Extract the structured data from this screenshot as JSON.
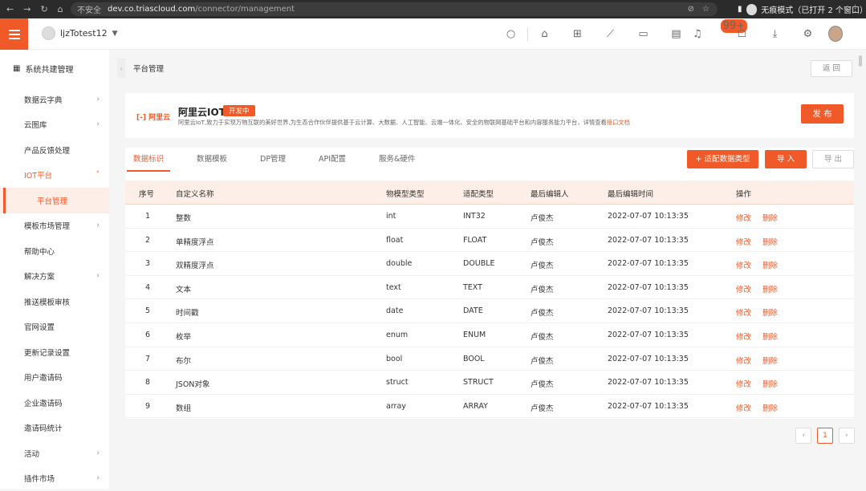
{
  "browser": {
    "security": "不安全",
    "url_host": "dev.co.triascloud.com",
    "url_path": "/connector/management",
    "incognito": "无痕模式（已打开 2 个窗口）"
  },
  "header": {
    "tenant": "ljzTotest12",
    "notification_count": "99+"
  },
  "sidebar": {
    "title": "系统共建管理",
    "items": [
      {
        "label": "数据云字典",
        "arrow": "›"
      },
      {
        "label": "云图库",
        "arrow": "›"
      },
      {
        "label": "产品反馈处理",
        "arrow": ""
      },
      {
        "label": "IOT平台",
        "arrow": "˄"
      },
      {
        "label": "平台管理",
        "arrow": ""
      },
      {
        "label": "模板市场管理",
        "arrow": "›"
      },
      {
        "label": "帮助中心",
        "arrow": ""
      },
      {
        "label": "解决方案",
        "arrow": "›"
      },
      {
        "label": "推送模板审核",
        "arrow": ""
      },
      {
        "label": "官网设置",
        "arrow": ""
      },
      {
        "label": "更新记录设置",
        "arrow": ""
      },
      {
        "label": "用户邀请码",
        "arrow": ""
      },
      {
        "label": "企业邀请码",
        "arrow": ""
      },
      {
        "label": "邀请码统计",
        "arrow": ""
      },
      {
        "label": "活动",
        "arrow": "›"
      },
      {
        "label": "插件市场",
        "arrow": "›"
      }
    ]
  },
  "breadcrumb": {
    "title": "平台管理",
    "return_label": "返 回"
  },
  "platform": {
    "logo_text": "[-] 阿里云",
    "name": "阿里云IOT",
    "status": "开发中",
    "description": "阿里云IoT,致力于实现万物互联的美好世界,为生态合作伙伴提供基于云计算、大数据、人工智能、云端一体化、安全的物联网基础平台和内容服务能力平台，详情查看",
    "doc_link": "接口文档",
    "publish_label": "发 布"
  },
  "tabs": [
    "数据标识",
    "数据模板",
    "DP管理",
    "API配置",
    "服务&硬件"
  ],
  "actions": {
    "adapt": "+ 适配数据类型",
    "import": "导 入",
    "export": "导 出"
  },
  "table": {
    "headers": [
      "序号",
      "自定义名称",
      "物模型类型",
      "适配类型",
      "最后编辑人",
      "最后编辑时间",
      "操作"
    ],
    "rows": [
      {
        "no": "1",
        "name": "整数",
        "model": "int",
        "adapt": "INT32",
        "editor": "卢俊杰",
        "time": "2022-07-07 10:13:35"
      },
      {
        "no": "2",
        "name": "单精度浮点",
        "model": "float",
        "adapt": "FLOAT",
        "editor": "卢俊杰",
        "time": "2022-07-07 10:13:35"
      },
      {
        "no": "3",
        "name": "双精度浮点",
        "model": "double",
        "adapt": "DOUBLE",
        "editor": "卢俊杰",
        "time": "2022-07-07 10:13:35"
      },
      {
        "no": "4",
        "name": "文本",
        "model": "text",
        "adapt": "TEXT",
        "editor": "卢俊杰",
        "time": "2022-07-07 10:13:35"
      },
      {
        "no": "5",
        "name": "时间戳",
        "model": "date",
        "adapt": "DATE",
        "editor": "卢俊杰",
        "time": "2022-07-07 10:13:35"
      },
      {
        "no": "6",
        "name": "枚举",
        "model": "enum",
        "adapt": "ENUM",
        "editor": "卢俊杰",
        "time": "2022-07-07 10:13:35"
      },
      {
        "no": "7",
        "name": "布尔",
        "model": "bool",
        "adapt": "BOOL",
        "editor": "卢俊杰",
        "time": "2022-07-07 10:13:35"
      },
      {
        "no": "8",
        "name": "JSON对象",
        "model": "struct",
        "adapt": "STRUCT",
        "editor": "卢俊杰",
        "time": "2022-07-07 10:13:35"
      },
      {
        "no": "9",
        "name": "数组",
        "model": "array",
        "adapt": "ARRAY",
        "editor": "卢俊杰",
        "time": "2022-07-07 10:13:35"
      }
    ],
    "edit_label": "修改",
    "delete_label": "删除"
  },
  "pagination": {
    "prev": "‹",
    "current": "1",
    "next": "›"
  },
  "colors": {
    "accent": "#f05a28"
  }
}
